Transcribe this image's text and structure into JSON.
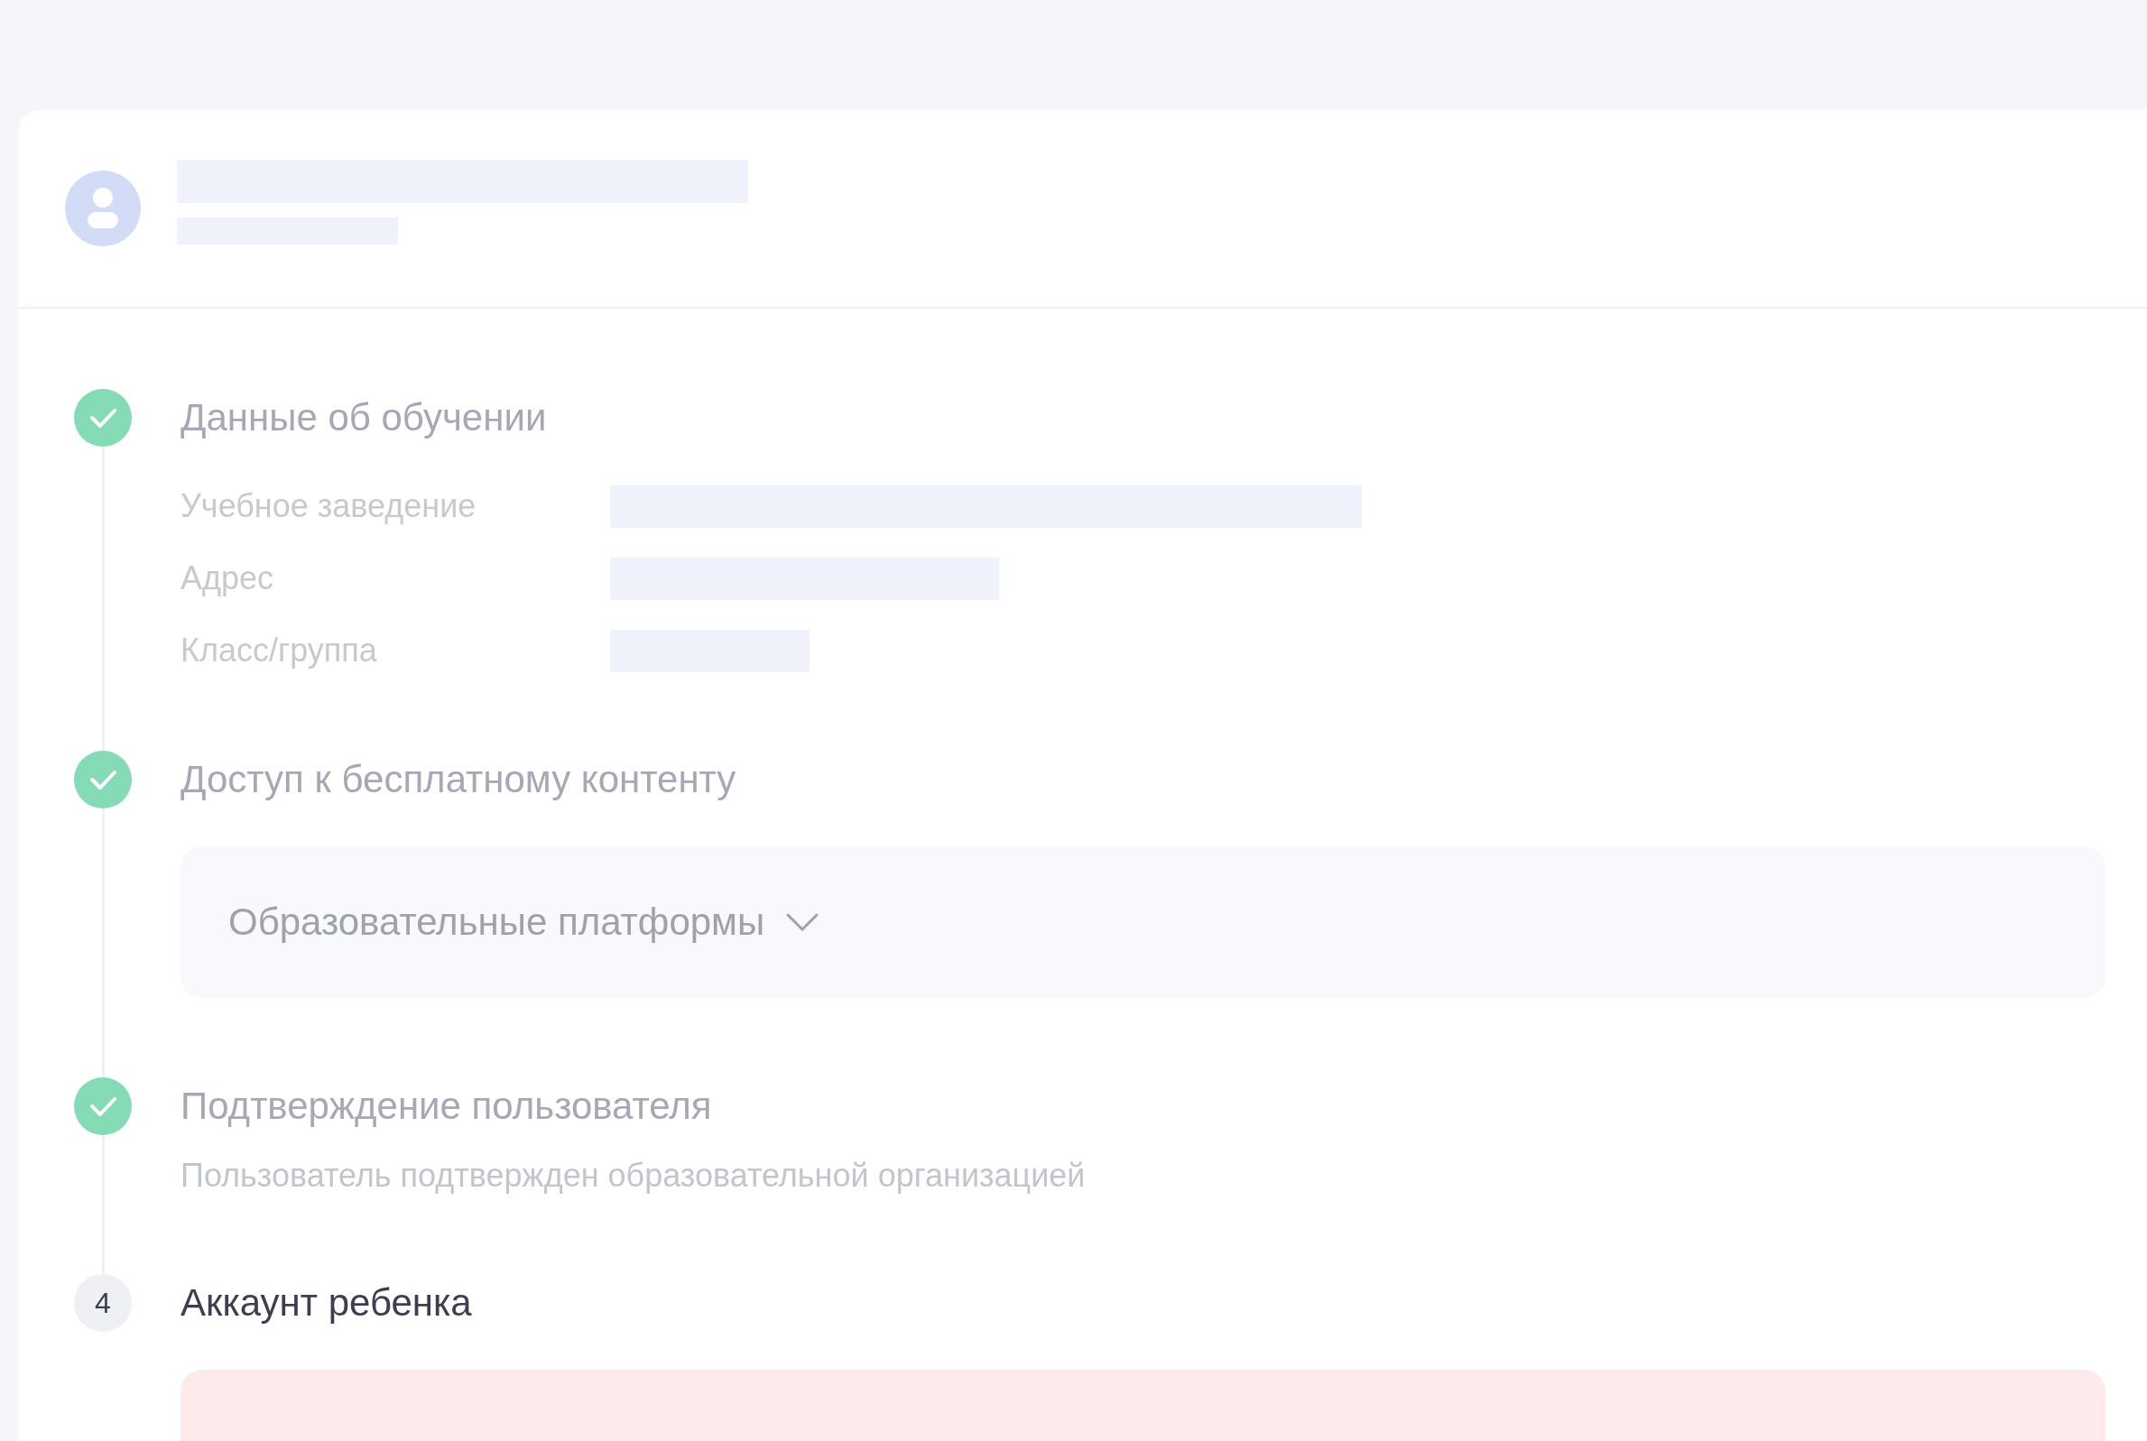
{
  "steps": [
    {
      "kind": "fields",
      "done": true,
      "title": "Данные об обучении",
      "fields": [
        {
          "label": "Учебное заведение"
        },
        {
          "label": "Адрес"
        },
        {
          "label": "Класс/группа"
        }
      ]
    },
    {
      "kind": "accordion",
      "done": true,
      "title": "Доступ к бесплатному контенту",
      "accordion": {
        "label": "Образовательные платформы",
        "expanded": false
      }
    },
    {
      "kind": "note",
      "done": true,
      "title": "Подтверждение пользователя",
      "note": "Пользователь подтвержден образовательной организацией"
    },
    {
      "kind": "alert",
      "done": false,
      "number": "4",
      "title": "Аккаунт ребенка"
    }
  ]
}
